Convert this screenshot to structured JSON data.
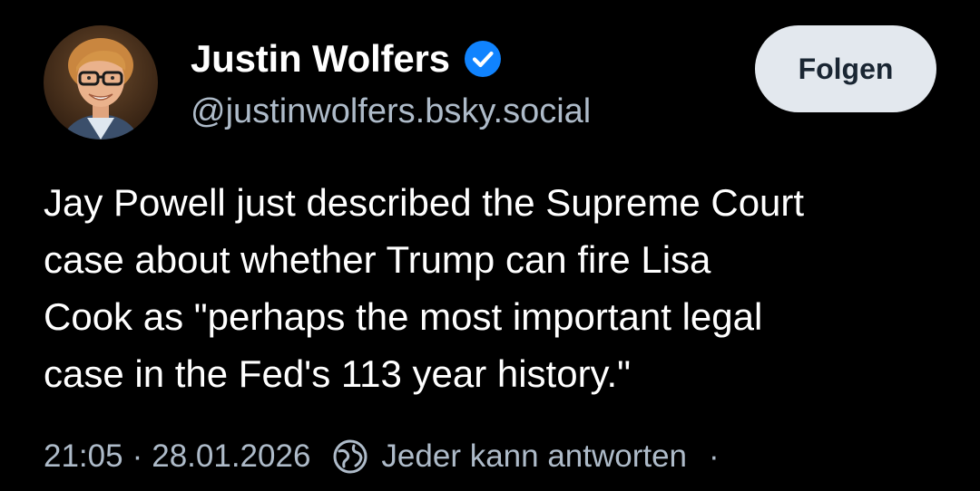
{
  "author": {
    "display_name": "Justin Wolfers",
    "handle": "@justinwolfers.bsky.social",
    "avatar_icon": "profile-photo",
    "verified_icon": "verified-check-icon"
  },
  "follow_button": {
    "label": "Folgen"
  },
  "post": {
    "text": "Jay Powell just described the Supreme Court\ncase about whether Trump can fire Lisa\nCook as \"perhaps the most important legal\ncase in the Fed's 113 year history.\""
  },
  "meta": {
    "time": "21:05",
    "separator": "·",
    "date": "28.01.2026",
    "reply_icon": "globe-reply-icon",
    "reply_setting": "Jeder kann antworten",
    "trailing_dot": "·"
  },
  "colors": {
    "background": "#000000",
    "text_primary": "#ffffff",
    "text_secondary": "#aebbc9",
    "verified_blue": "#1083fe",
    "button_background": "#e3e8ee",
    "button_text": "#1a2633"
  }
}
